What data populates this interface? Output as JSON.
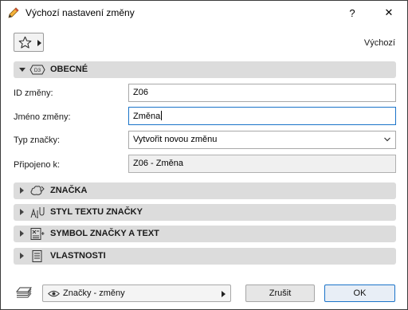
{
  "window": {
    "title": "Výchozí nastavení změny",
    "help_label": "?",
    "close_label": "✕"
  },
  "toolbar": {
    "favorites_icon": "star-icon",
    "preset_label": "Výchozí"
  },
  "sections": {
    "general": {
      "label": "OBECNÉ",
      "expanded": true,
      "icon": "marker-d3-icon"
    },
    "marker": {
      "label": "ZNAČKA",
      "expanded": false,
      "icon": "cloud-marker-icon"
    },
    "text_style": {
      "label": "STYL TEXTU ZNAČKY",
      "expanded": false,
      "icon": "text-style-icon"
    },
    "symbol_text": {
      "label": "SYMBOL ZNAČKY A TEXT",
      "expanded": false,
      "icon": "symbol-text-icon"
    },
    "properties": {
      "label": "VLASTNOSTI",
      "expanded": false,
      "icon": "document-icon"
    }
  },
  "fields": {
    "change_id": {
      "label": "ID změny:",
      "value": "Z06"
    },
    "change_name": {
      "label": "Jméno změny:",
      "value": "Změna"
    },
    "marker_type": {
      "label": "Typ značky:",
      "value": "Vytvořit novou změnu"
    },
    "attached_to": {
      "label": "Připojeno k:",
      "value": "Z06 - Změna"
    }
  },
  "footer": {
    "layer_icon": "layer-icon",
    "layer_value": "Značky - změny",
    "cancel_label": "Zrušit",
    "ok_label": "OK"
  },
  "colors": {
    "accent": "#1a73c9",
    "section_bg": "#dcdcdc"
  }
}
